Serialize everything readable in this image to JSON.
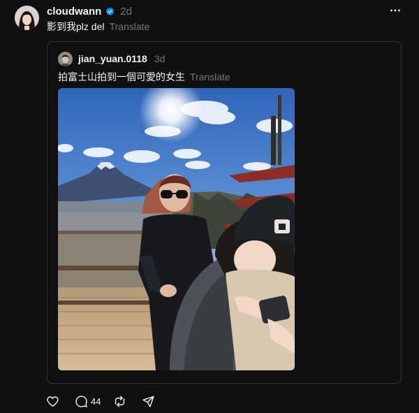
{
  "post": {
    "username": "cloudwann",
    "time": "2d",
    "caption": "影到我plz del",
    "translate_label": "Translate",
    "verified": true
  },
  "quoted": {
    "username": "jian_yuan.0118",
    "time": "3d",
    "caption": "拍富士山拍到一個可愛的女生",
    "translate_label": "Translate"
  },
  "actions": {
    "like_count": "",
    "reply_count": "44",
    "repost_count": "",
    "share_count": ""
  },
  "colors": {
    "background": "#101010",
    "text": "#f3f5f7",
    "muted": "#777777",
    "border": "#333638",
    "verified": "#0095f6"
  }
}
